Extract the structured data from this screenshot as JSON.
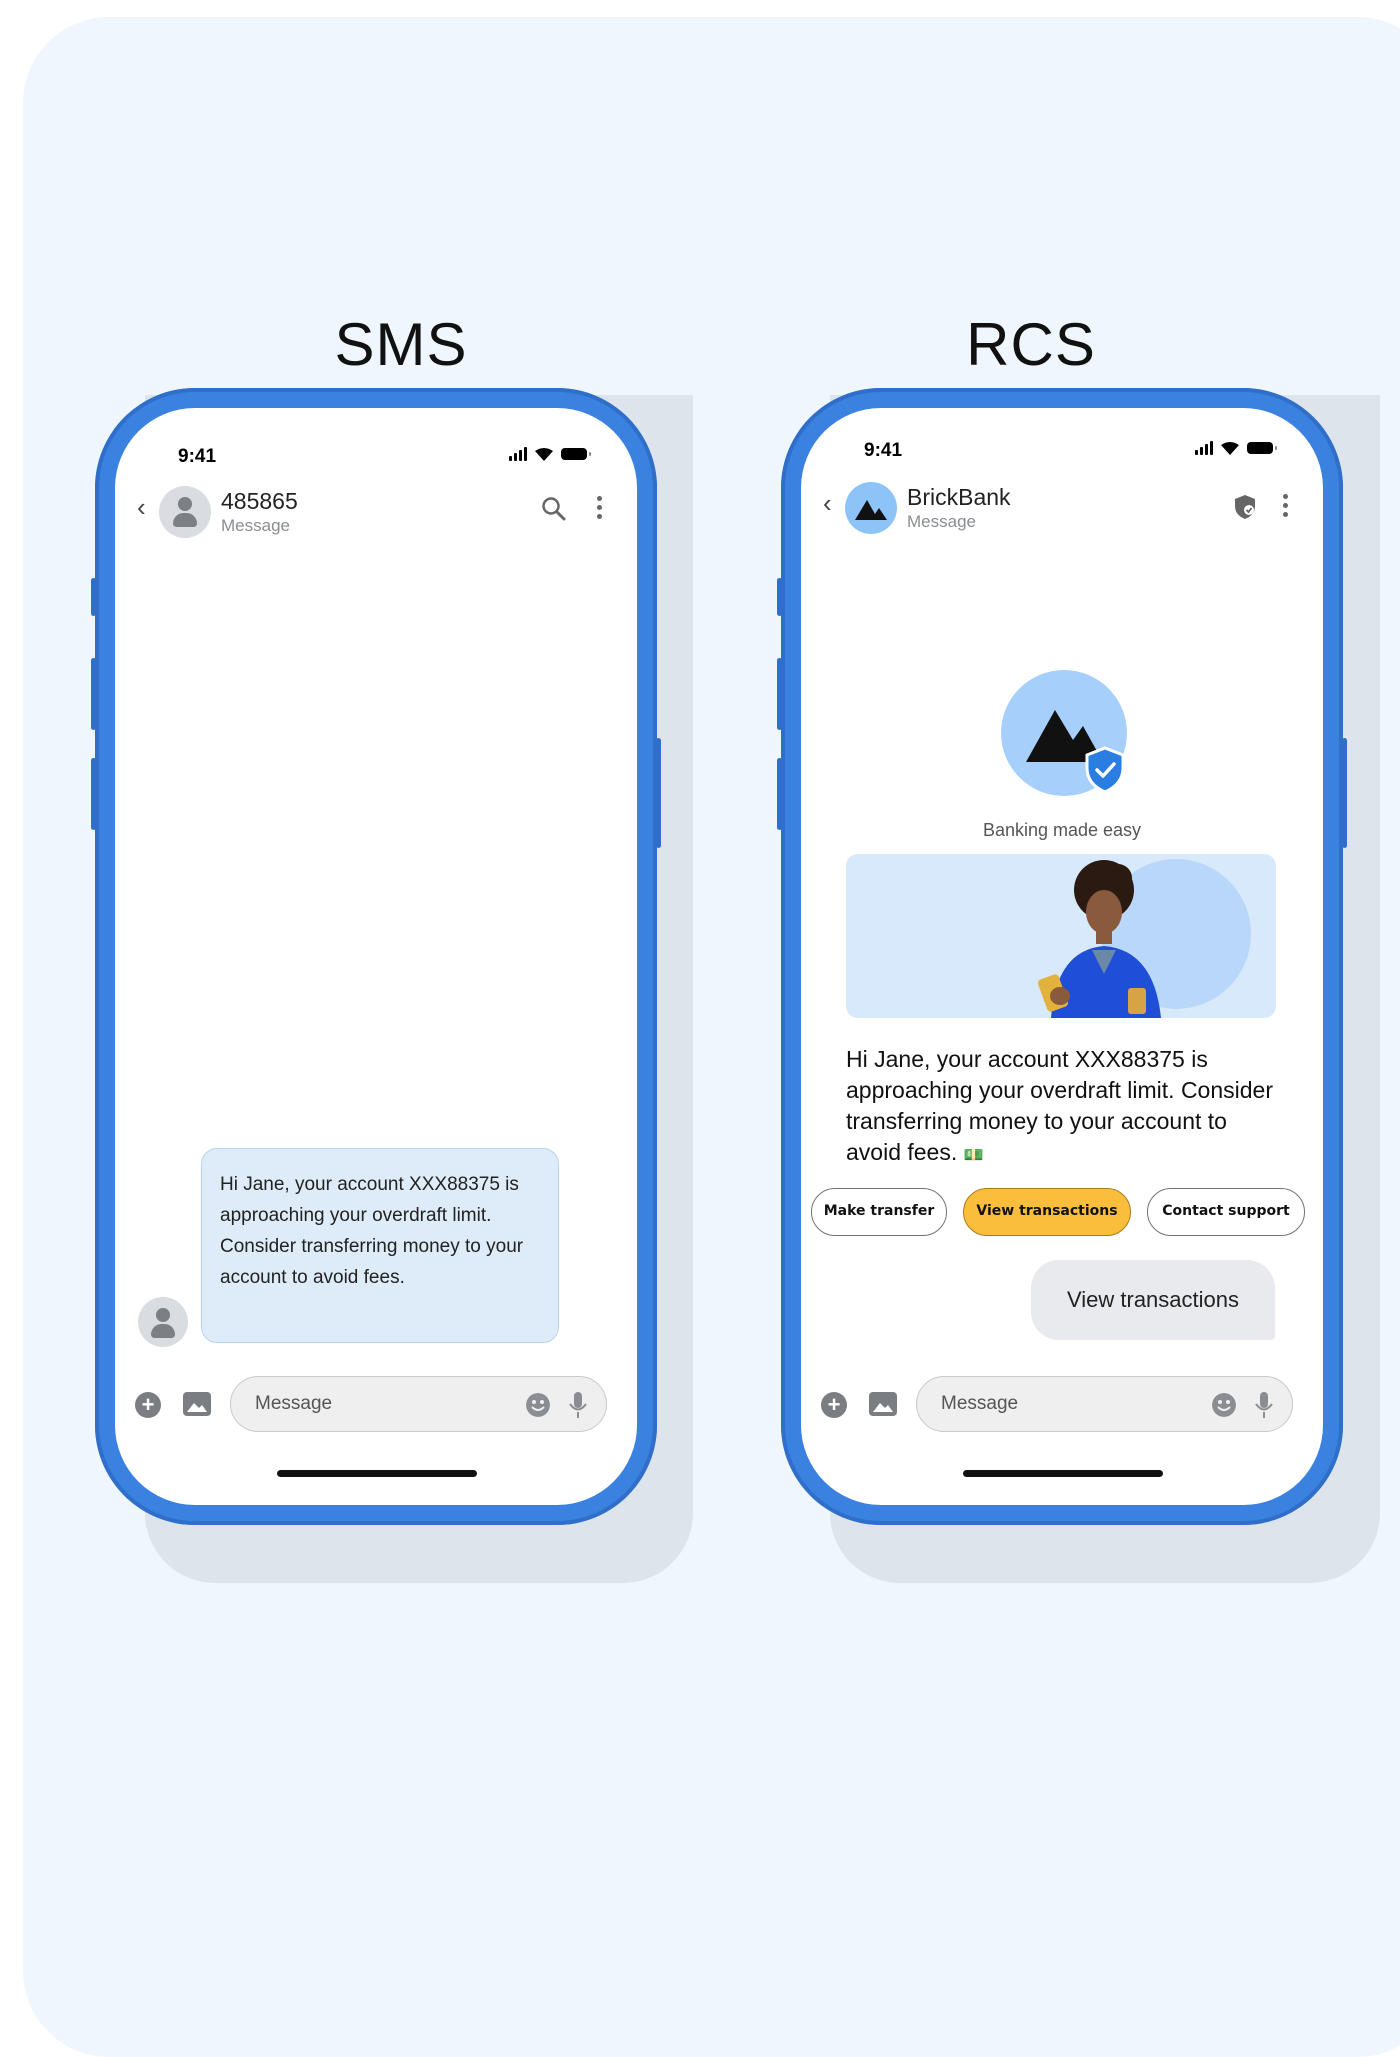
{
  "sms": {
    "heading": "SMS",
    "status": {
      "time": "9:41"
    },
    "contact": {
      "name": "485865",
      "subtitle": "Message"
    },
    "message": "Hi Jane, your account XXX88375 is approaching your overdraft limit. Consider transferring money to your account to avoid fees.",
    "composer": {
      "placeholder": "Message"
    }
  },
  "rcs": {
    "heading": "RCS",
    "status": {
      "time": "9:41"
    },
    "contact": {
      "name": "BrickBank",
      "subtitle": "Message"
    },
    "tagline": "Banking made easy",
    "message": "Hi Jane, your account XXX88375 is approaching your overdraft limit. Consider transferring money to your account to avoid fees.",
    "message_emoji": "💵",
    "suggestions": [
      "Make transfer",
      "View transactions",
      "Contact support"
    ],
    "active_suggestion": "View transactions",
    "sent_reply": "View transactions",
    "composer": {
      "placeholder": "Message"
    }
  },
  "colors": {
    "background": "#eff6fd",
    "phone_frame": "#3b82e0",
    "sms_bubble": "#deecf9",
    "brand_circle": "#a6d0fb",
    "chip_active": "#fbbd3c",
    "verified_badge": "#2a7de1"
  }
}
